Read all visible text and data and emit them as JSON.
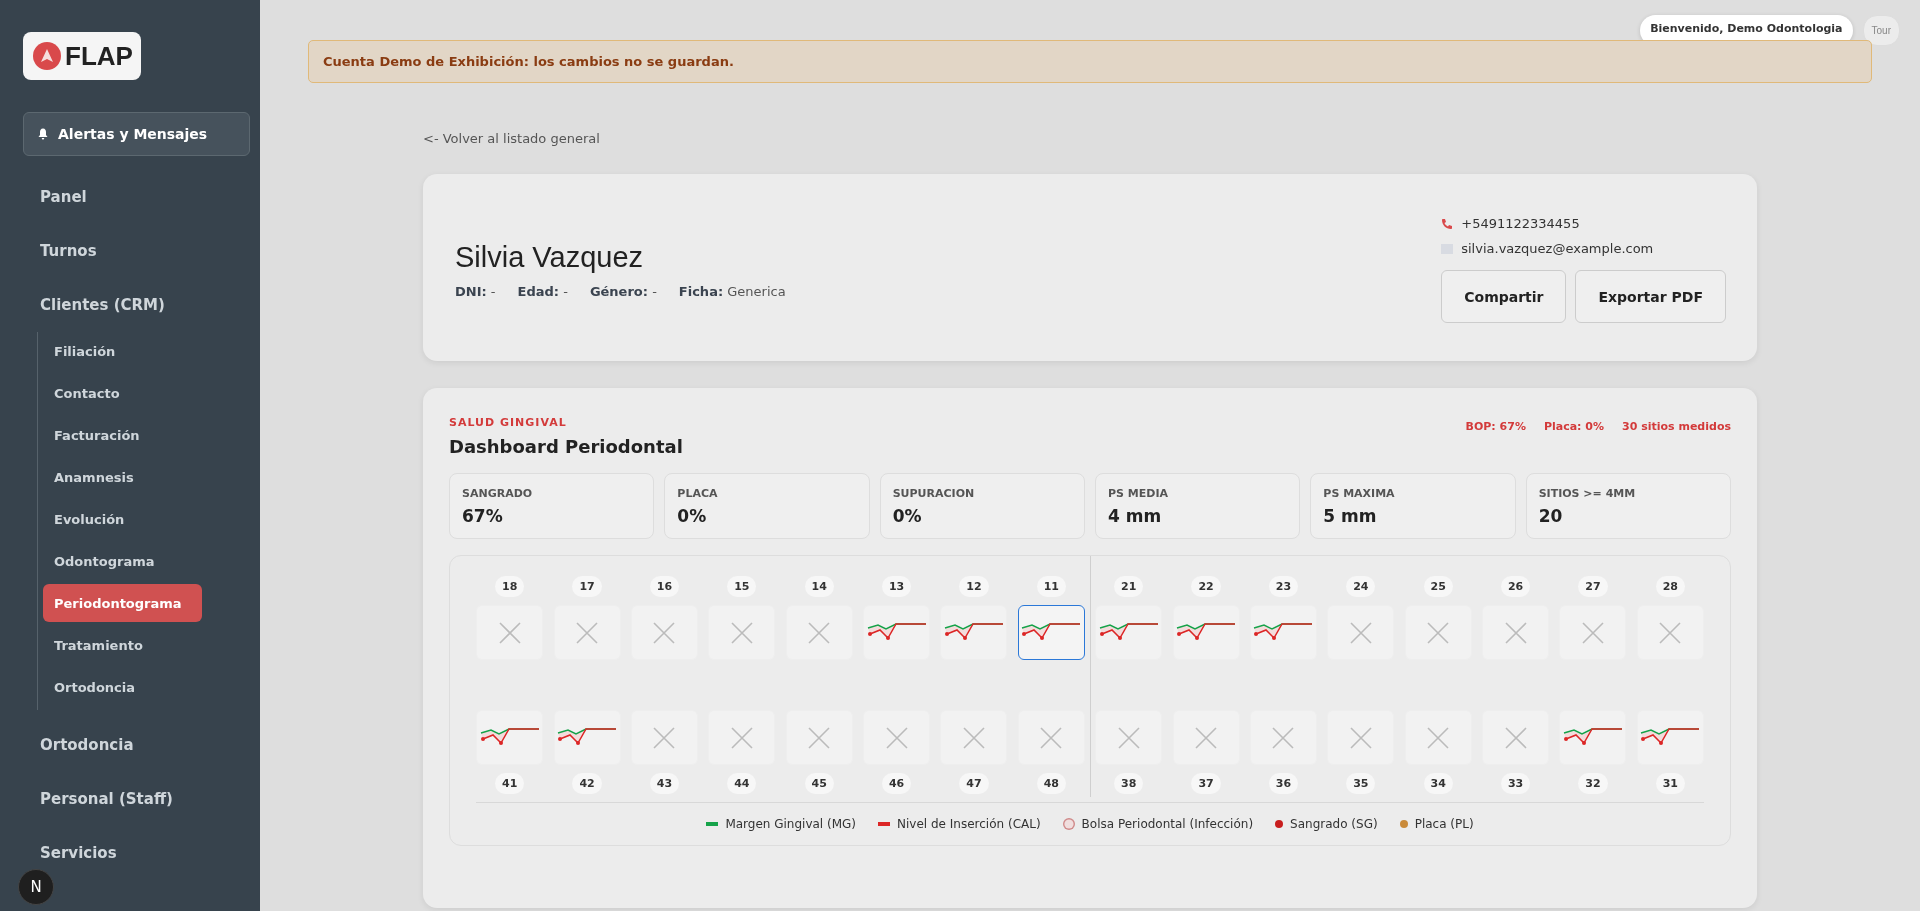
{
  "sidebar": {
    "logo": "FLAP",
    "alerts_button": "Alertas y Mensajes",
    "items": [
      {
        "label": "Panel",
        "selected": false
      },
      {
        "label": "Turnos",
        "selected": false
      },
      {
        "label": "Clientes (CRM)",
        "selected": false,
        "children": [
          {
            "label": "Filiación",
            "selected": false
          },
          {
            "label": "Contacto",
            "selected": false
          },
          {
            "label": "Facturación",
            "selected": false
          },
          {
            "label": "Anamnesis",
            "selected": false
          },
          {
            "label": "Evolución",
            "selected": false
          },
          {
            "label": "Odontograma",
            "selected": false
          },
          {
            "label": "Periodontograma",
            "selected": true
          },
          {
            "label": "Tratamiento",
            "selected": false
          },
          {
            "label": "Ortodoncia",
            "selected": false
          }
        ]
      },
      {
        "label": "Ortodoncia",
        "selected": false
      },
      {
        "label": "Personal (Staff)",
        "selected": false
      },
      {
        "label": "Servicios",
        "selected": false
      }
    ],
    "dev_badge": "N"
  },
  "header": {
    "welcome": "Bienvenido, Demo Odontologia",
    "tour": "Tour"
  },
  "banner": "Cuenta Demo de Exhibición: los cambios no se guardan.",
  "back_link": "<- Volver al listado general",
  "patient": {
    "name": "Silvia Vazquez",
    "fields": [
      {
        "label": "DNI:",
        "value": "-"
      },
      {
        "label": "Edad:",
        "value": "-"
      },
      {
        "label": "Género:",
        "value": "-"
      },
      {
        "label": "Ficha:",
        "value": "Generica"
      }
    ],
    "phone": "+5491122334455",
    "email": "silvia.vazquez@example.com",
    "buttons": [
      "Compartir",
      "Exportar PDF"
    ]
  },
  "dashboard": {
    "eyebrow": "SALUD GINGIVAL",
    "title": "Dashboard Periodontal",
    "summary": [
      "BOP: 67%",
      "Placa: 0%",
      "30 sitios medidos"
    ],
    "stats": [
      {
        "label": "SANGRADO",
        "value": "67%"
      },
      {
        "label": "PLACA",
        "value": "0%"
      },
      {
        "label": "SUPURACION",
        "value": "0%"
      },
      {
        "label": "PS MEDIA",
        "value": "4 mm"
      },
      {
        "label": "PS MAXIMA",
        "value": "5 mm"
      },
      {
        "label": "SITIOS >= 4MM",
        "value": "20"
      }
    ],
    "upper_teeth": [
      {
        "number": "18",
        "kind": "missing",
        "selected": false
      },
      {
        "number": "17",
        "kind": "missing",
        "selected": false
      },
      {
        "number": "16",
        "kind": "missing",
        "selected": false
      },
      {
        "number": "15",
        "kind": "missing",
        "selected": false
      },
      {
        "number": "14",
        "kind": "missing",
        "selected": false
      },
      {
        "number": "13",
        "kind": "chart",
        "selected": false
      },
      {
        "number": "12",
        "kind": "chart",
        "selected": false
      },
      {
        "number": "11",
        "kind": "chart",
        "selected": true
      },
      {
        "number": "21",
        "kind": "chart",
        "selected": false
      },
      {
        "number": "22",
        "kind": "chart",
        "selected": false
      },
      {
        "number": "23",
        "kind": "chart",
        "selected": false
      },
      {
        "number": "24",
        "kind": "missing",
        "selected": false
      },
      {
        "number": "25",
        "kind": "missing",
        "selected": false
      },
      {
        "number": "26",
        "kind": "missing",
        "selected": false
      },
      {
        "number": "27",
        "kind": "missing",
        "selected": false
      },
      {
        "number": "28",
        "kind": "missing",
        "selected": false
      }
    ],
    "lower_teeth": [
      {
        "number": "41",
        "kind": "chart",
        "selected": false
      },
      {
        "number": "42",
        "kind": "chart",
        "selected": false
      },
      {
        "number": "43",
        "kind": "missing",
        "selected": false
      },
      {
        "number": "44",
        "kind": "missing",
        "selected": false
      },
      {
        "number": "45",
        "kind": "missing",
        "selected": false
      },
      {
        "number": "46",
        "kind": "missing",
        "selected": false
      },
      {
        "number": "47",
        "kind": "missing",
        "selected": false
      },
      {
        "number": "48",
        "kind": "missing",
        "selected": false
      },
      {
        "number": "38",
        "kind": "missing",
        "selected": false
      },
      {
        "number": "37",
        "kind": "missing",
        "selected": false
      },
      {
        "number": "36",
        "kind": "missing",
        "selected": false
      },
      {
        "number": "35",
        "kind": "missing",
        "selected": false
      },
      {
        "number": "34",
        "kind": "missing",
        "selected": false
      },
      {
        "number": "33",
        "kind": "missing",
        "selected": false
      },
      {
        "number": "32",
        "kind": "chart",
        "selected": false
      },
      {
        "number": "31",
        "kind": "chart",
        "selected": false
      }
    ],
    "legend": [
      {
        "label": "Margen Gingival (MG)",
        "kind": "line",
        "color": "#16a34a"
      },
      {
        "label": "Nivel de Inserción (CAL)",
        "kind": "line",
        "color": "#dc2626"
      },
      {
        "label": "Bolsa Periodontal (Infección)",
        "kind": "ring",
        "color": "#d08a8a"
      },
      {
        "label": "Sangrado (SG)",
        "kind": "dot",
        "color": "#c81e1e"
      },
      {
        "label": "Placa (PL)",
        "kind": "dot",
        "color": "#c98a3a"
      }
    ]
  }
}
